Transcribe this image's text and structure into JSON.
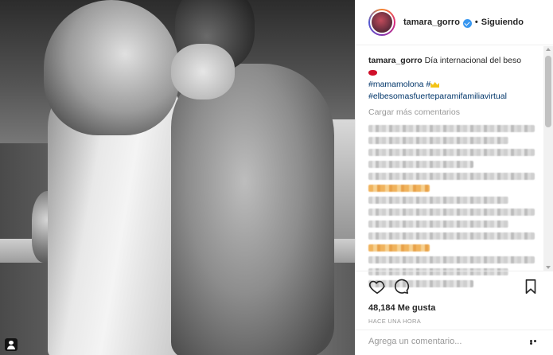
{
  "header": {
    "username": "tamara_gorro",
    "separator": "•",
    "follow_status": "Siguiendo"
  },
  "caption": {
    "username": "tamara_gorro",
    "text": "Día internacional del beso",
    "hashtag_1": "#mamamolona",
    "hashtag_2": "#",
    "hashtag_3": "#elbesomasfuerteparamifamiliavirtual"
  },
  "comments": {
    "load_more": "Cargar más comentarios"
  },
  "actions": {
    "likes": "48,184 Me gusta",
    "time_ago": "HACE UNA HORA"
  },
  "add_comment": {
    "placeholder": "Agrega un comentario..."
  },
  "icons": {
    "heart": "heart-icon",
    "comment": "comment-icon",
    "save": "bookmark-icon",
    "more": "more-options-icon",
    "verified": "verified-badge-icon",
    "tag": "tagged-people-icon"
  },
  "colors": {
    "hashtag": "#003569",
    "verified": "#3897f0",
    "muted": "#999999",
    "text": "#262626"
  }
}
